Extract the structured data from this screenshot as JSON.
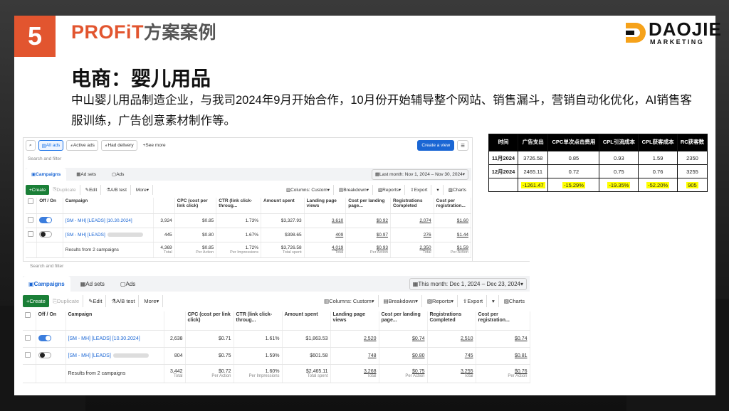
{
  "slide": {
    "number": "5",
    "brand_title": "PROFiT",
    "brand_title_cn": "方案案例",
    "logo_text": "DAOJIE",
    "logo_sub": "MARKETING",
    "heading": "电商：婴儿用品",
    "description": "中山婴儿用品制造企业，与我司2024年9月开始合作，10月份开始辅导整个网站、销售漏斗，营销自动化优化，AI销售客服训练，广告创意素材制作等。"
  },
  "summary_table": {
    "headers": [
      "时间",
      "广告支出",
      "CPC单次点击费用",
      "CPL引流成本",
      "CPL获客成本",
      "RC获客数"
    ],
    "rows": [
      [
        "11月2024",
        "3726.58",
        "0.85",
        "0.93",
        "1.59",
        "2350"
      ],
      [
        "12月2024",
        "2465.11",
        "0.72",
        "0.75",
        "0.76",
        "3255"
      ],
      [
        "",
        "-1261.47",
        "-15.29%",
        "-19.35%",
        "-52.20%",
        "905"
      ]
    ]
  },
  "report1": {
    "filters": [
      "All ads",
      "Active ads",
      "Had delivery",
      "See more"
    ],
    "create_view": "Create a view",
    "search_placeholder": "Search and filter",
    "tabs": [
      "Campaigns",
      "Ad sets",
      "Ads"
    ],
    "date_range": "Last month: Nov 1, 2024 – Nov 30, 2024",
    "toolbar": [
      "Create",
      "Duplicate",
      "Edit",
      "A/B test",
      "More",
      "Columns: Custom",
      "Breakdown",
      "Reports",
      "Export",
      "Charts"
    ],
    "columns": [
      "Off / On",
      "Campaign",
      "",
      "CPC (cost per link click)",
      "CTR (link click-throug...",
      "Amount spent",
      "Landing page views",
      "Cost per landing page...",
      "Registrations Completed",
      "Cost per registration..."
    ],
    "rows": [
      {
        "name": "[SM - MH] [LEADS] [10.30.2024]",
        "on": true,
        "results": "3,924",
        "cpc": "$0.85",
        "ctr": "1.73%",
        "spent": "$3,327.93",
        "lpv": "3,610",
        "cplpv": "$0.92",
        "reg": "2,074",
        "cpreg": "$1.60"
      },
      {
        "name": "[SM - MH] [LEADS]",
        "on": false,
        "results": "445",
        "cpc": "$0.80",
        "ctr": "1.67%",
        "spent": "$398.65",
        "lpv": "409",
        "cplpv": "$0.97",
        "reg": "276",
        "cpreg": "$1.44"
      }
    ],
    "total": {
      "label": "Results from 2 campaigns",
      "results": "4,369",
      "cpc": "$0.85",
      "ctr": "1.72%",
      "spent": "$3,726.58",
      "lpv": "4,019",
      "cplpv": "$0.93",
      "reg": "2,350",
      "cpreg": "$1.59"
    },
    "total_subs": {
      "results": "Total",
      "cpc": "Per Action",
      "ctr": "Per Impressions",
      "spent": "Total spent",
      "lpv": "Total",
      "cplpv": "Per Action",
      "reg": "Total",
      "cpreg": "Per Action"
    }
  },
  "report2": {
    "search_placeholder": "Search and filter",
    "tabs": [
      "Campaigns",
      "Ad sets",
      "Ads"
    ],
    "date_range": "This month: Dec 1, 2024 – Dec 23, 2024",
    "toolbar": [
      "Create",
      "Duplicate",
      "Edit",
      "A/B test",
      "More",
      "Columns: Custom",
      "Breakdown",
      "Reports",
      "Export",
      "Charts"
    ],
    "columns": [
      "Off / On",
      "Campaign",
      "",
      "CPC (cost per link click)",
      "CTR (link click-throug...",
      "Amount spent",
      "Landing page views",
      "Cost per landing page...",
      "Registrations Completed",
      "Cost per registration..."
    ],
    "rows": [
      {
        "name": "[SM - MH] [LEADS] [10.30.2024]",
        "on": true,
        "results": "2,638",
        "cpc": "$0.71",
        "ctr": "1.61%",
        "spent": "$1,863.53",
        "lpv": "2,520",
        "cplpv": "$0.74",
        "reg": "2,510",
        "cpreg": "$0.74"
      },
      {
        "name": "[SM - MH] [LEADS]",
        "on": false,
        "results": "804",
        "cpc": "$0.75",
        "ctr": "1.59%",
        "spent": "$601.58",
        "lpv": "748",
        "cplpv": "$0.80",
        "reg": "745",
        "cpreg": "$0.81"
      }
    ],
    "total": {
      "label": "Results from 2 campaigns",
      "results": "3,442",
      "cpc": "$0.72",
      "ctr": "1.60%",
      "spent": "$2,465.11",
      "lpv": "3,268",
      "cplpv": "$0.75",
      "reg": "3,255",
      "cpreg": "$0.76"
    },
    "total_subs": {
      "results": "Total",
      "cpc": "Per Action",
      "ctr": "Per Impressions",
      "spent": "Total spent",
      "lpv": "Total",
      "cplpv": "Per Action",
      "reg": "Total",
      "cpreg": "Per Action"
    }
  },
  "colors": {
    "accent": "#e2552f",
    "highlight": "#ffff00",
    "fb_blue": "#1a66d4",
    "create_green": "#1a7f37"
  }
}
